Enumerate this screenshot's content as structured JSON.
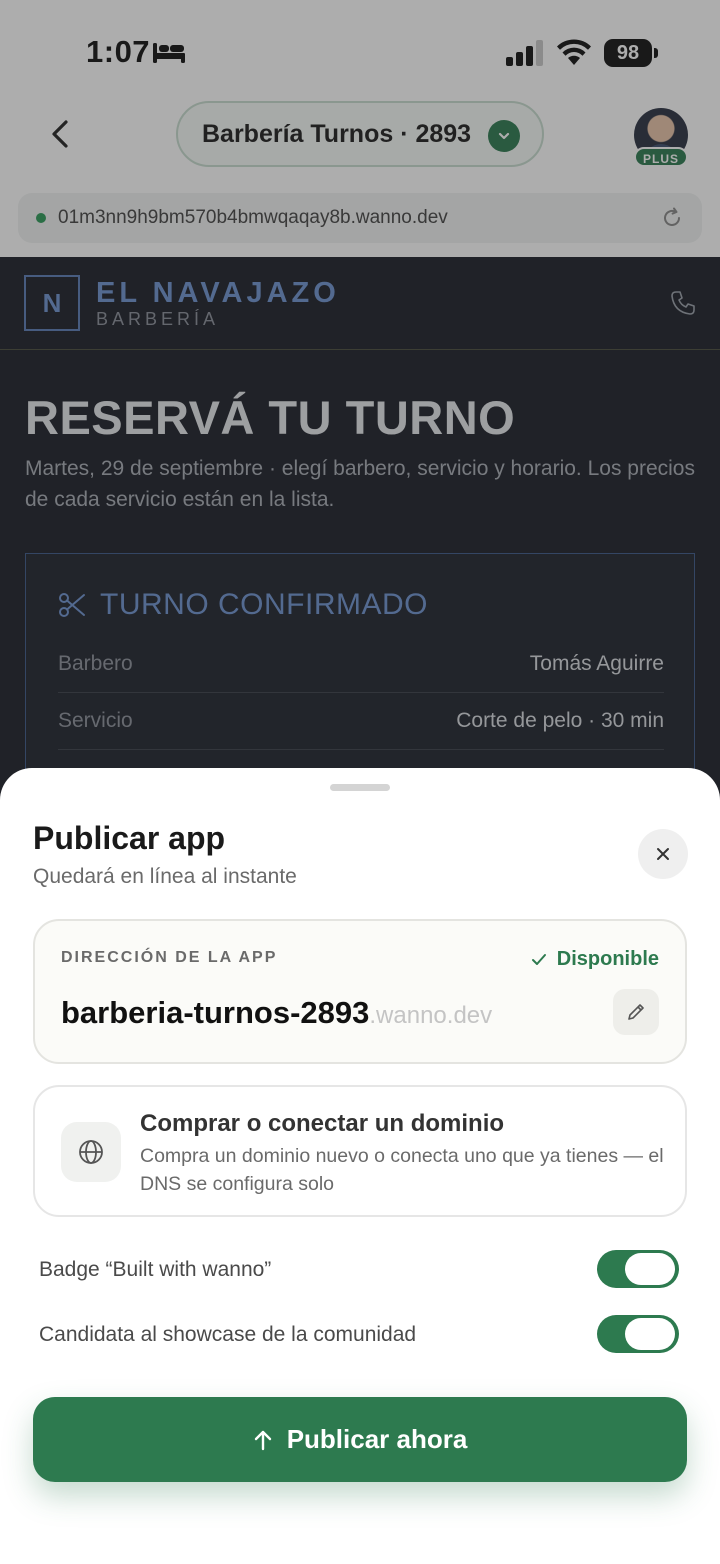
{
  "status_bar": {
    "time": "1:07",
    "battery": "98"
  },
  "nav": {
    "project_name": "Barbería Turnos · 2893",
    "plan_badge": "PLUS"
  },
  "url_bar": {
    "url": "01m3nn9h9bm570b4bmwqaqay8b.wanno.dev"
  },
  "site": {
    "logo_letter": "N",
    "brand": "EL NAVAJAZO",
    "brand_sub": "BARBERÍA",
    "hero_title": "RESERVÁ TU TURNO",
    "hero_subtitle": "Martes, 29 de septiembre · elegí barbero, servicio y horario. Los precios de cada servicio están en la lista.",
    "confirm_title": "TURNO CONFIRMADO",
    "rows": [
      {
        "key": "Barbero",
        "value": "Tomás Aguirre"
      },
      {
        "key": "Servicio",
        "value": "Corte de pelo · 30 min"
      }
    ]
  },
  "sheet": {
    "title": "Publicar app",
    "subtitle": "Quedará en línea al instante",
    "address_label": "DIRECCIÓN DE LA APP",
    "address_status": "Disponible",
    "address_slug": "barberia-turnos-2893",
    "address_domain": ".wanno.dev",
    "domain_title": "Comprar o conectar un dominio",
    "domain_desc": "Compra un dominio nuevo o conecta uno que ya tienes — el DNS se configura solo",
    "toggles": [
      {
        "label": "Badge “Built with wanno”",
        "on": true
      },
      {
        "label": "Candidata al showcase de la comunidad",
        "on": true
      }
    ],
    "publish_label": "Publicar ahora"
  },
  "colors": {
    "accent": "#2d7a4f",
    "site_bg": "#1c2029",
    "site_accent": "#6f93d0"
  }
}
